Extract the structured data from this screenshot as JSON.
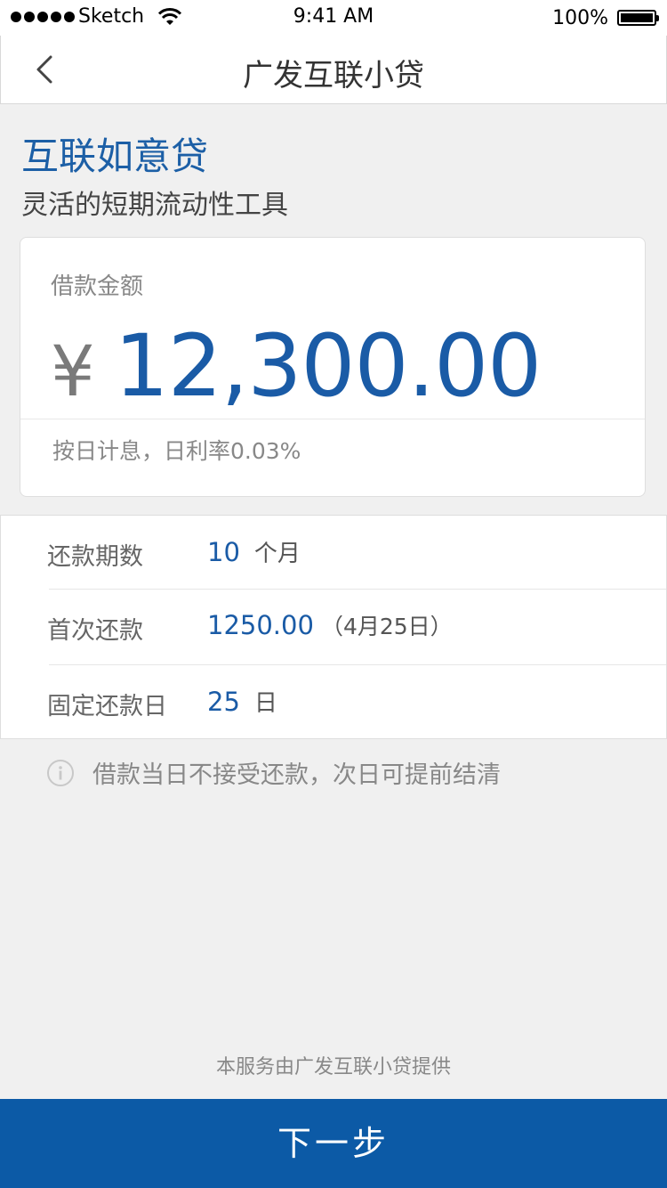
{
  "status_bar": {
    "carrier": "Sketch",
    "time": "9:41 AM",
    "battery": "100%",
    "battery_level": 1.0
  },
  "nav": {
    "title": "广发互联小贷",
    "back_icon": "chevron-left-icon"
  },
  "product": {
    "title": "互联如意贷",
    "subtitle": "灵活的短期流动性工具"
  },
  "amount_card": {
    "label": "借款金额",
    "currency": "¥",
    "amount": "12,300.00",
    "note": "按日计息，日利率0.03%"
  },
  "details": [
    {
      "label": "还款期数",
      "value": "10",
      "unit": "个月"
    },
    {
      "label": "首次还款",
      "value": "1250.00",
      "extra": "（4月25日）"
    },
    {
      "label": "固定还款日",
      "value": "25",
      "unit": "日"
    }
  ],
  "notice": {
    "icon": "info-icon",
    "text": "借款当日不接受还款，次日可提前结清"
  },
  "footer": {
    "provider": "本服务由广发互联小贷提供",
    "next_label": "下一步"
  },
  "colors": {
    "accent": "#1a5ba6",
    "button": "#0c5aa6",
    "background": "#f0f0f0"
  }
}
